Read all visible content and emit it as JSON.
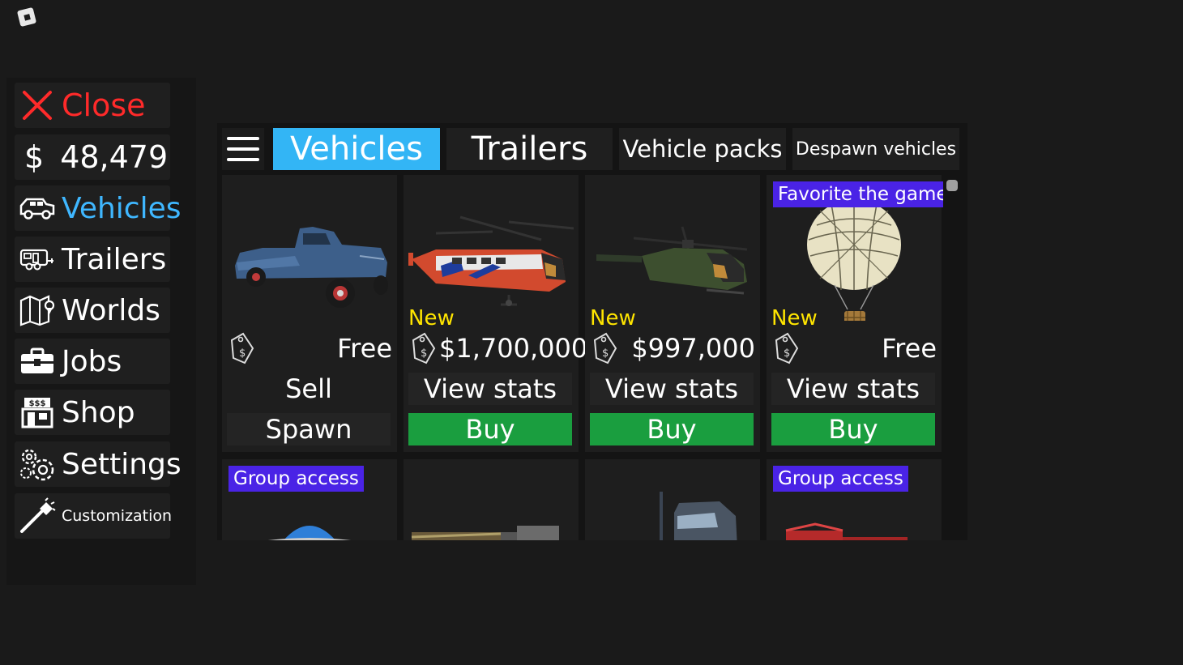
{
  "sidebar": {
    "close_label": "Close",
    "money_symbol": "$",
    "money_value": "48,479",
    "items": [
      {
        "label": "Vehicles",
        "icon": "jeep-icon",
        "active": true
      },
      {
        "label": "Trailers",
        "icon": "trailer-icon",
        "active": false
      },
      {
        "label": "Worlds",
        "icon": "map-icon",
        "active": false
      },
      {
        "label": "Jobs",
        "icon": "briefcase-icon",
        "active": false
      },
      {
        "label": "Shop",
        "icon": "shop-icon",
        "active": false
      },
      {
        "label": "Settings",
        "icon": "gears-icon",
        "active": false
      },
      {
        "label": "Customization",
        "icon": "paintbrush-icon",
        "active": false
      }
    ]
  },
  "tabs": [
    {
      "label": "Vehicles",
      "active": true
    },
    {
      "label": "Trailers",
      "active": false
    },
    {
      "label": "Vehicle packs",
      "active": false
    },
    {
      "label": "Despawn vehicles",
      "active": false
    }
  ],
  "cards": [
    {
      "vehicle": "pickup-truck",
      "new": "",
      "price": "Free",
      "secondary": "Sell",
      "primary": "Spawn"
    },
    {
      "vehicle": "red-helicopter",
      "new": "New",
      "price": "$1,700,000",
      "secondary": "View stats",
      "primary": "Buy"
    },
    {
      "vehicle": "green-helicopter",
      "new": "New",
      "price": "$997,000",
      "secondary": "View stats",
      "primary": "Buy"
    },
    {
      "vehicle": "hot-air-balloon",
      "ribbon": "Favorite the game",
      "new": "New",
      "price": "Free",
      "secondary": "View stats",
      "primary": "Buy"
    }
  ],
  "row2": [
    {
      "ribbon": "Group access",
      "vehicle": "blue-dome"
    },
    {
      "ribbon": "",
      "vehicle": "flatbed-trailer"
    },
    {
      "ribbon": "",
      "vehicle": "semi-truck"
    },
    {
      "ribbon": "Group access",
      "vehicle": "red-crane"
    }
  ],
  "colors": {
    "accent": "#33b5f5",
    "close": "#ff2a2a",
    "buy": "#1a9e3f",
    "ribbon": "#4a23e6",
    "new": "#ffe500"
  }
}
